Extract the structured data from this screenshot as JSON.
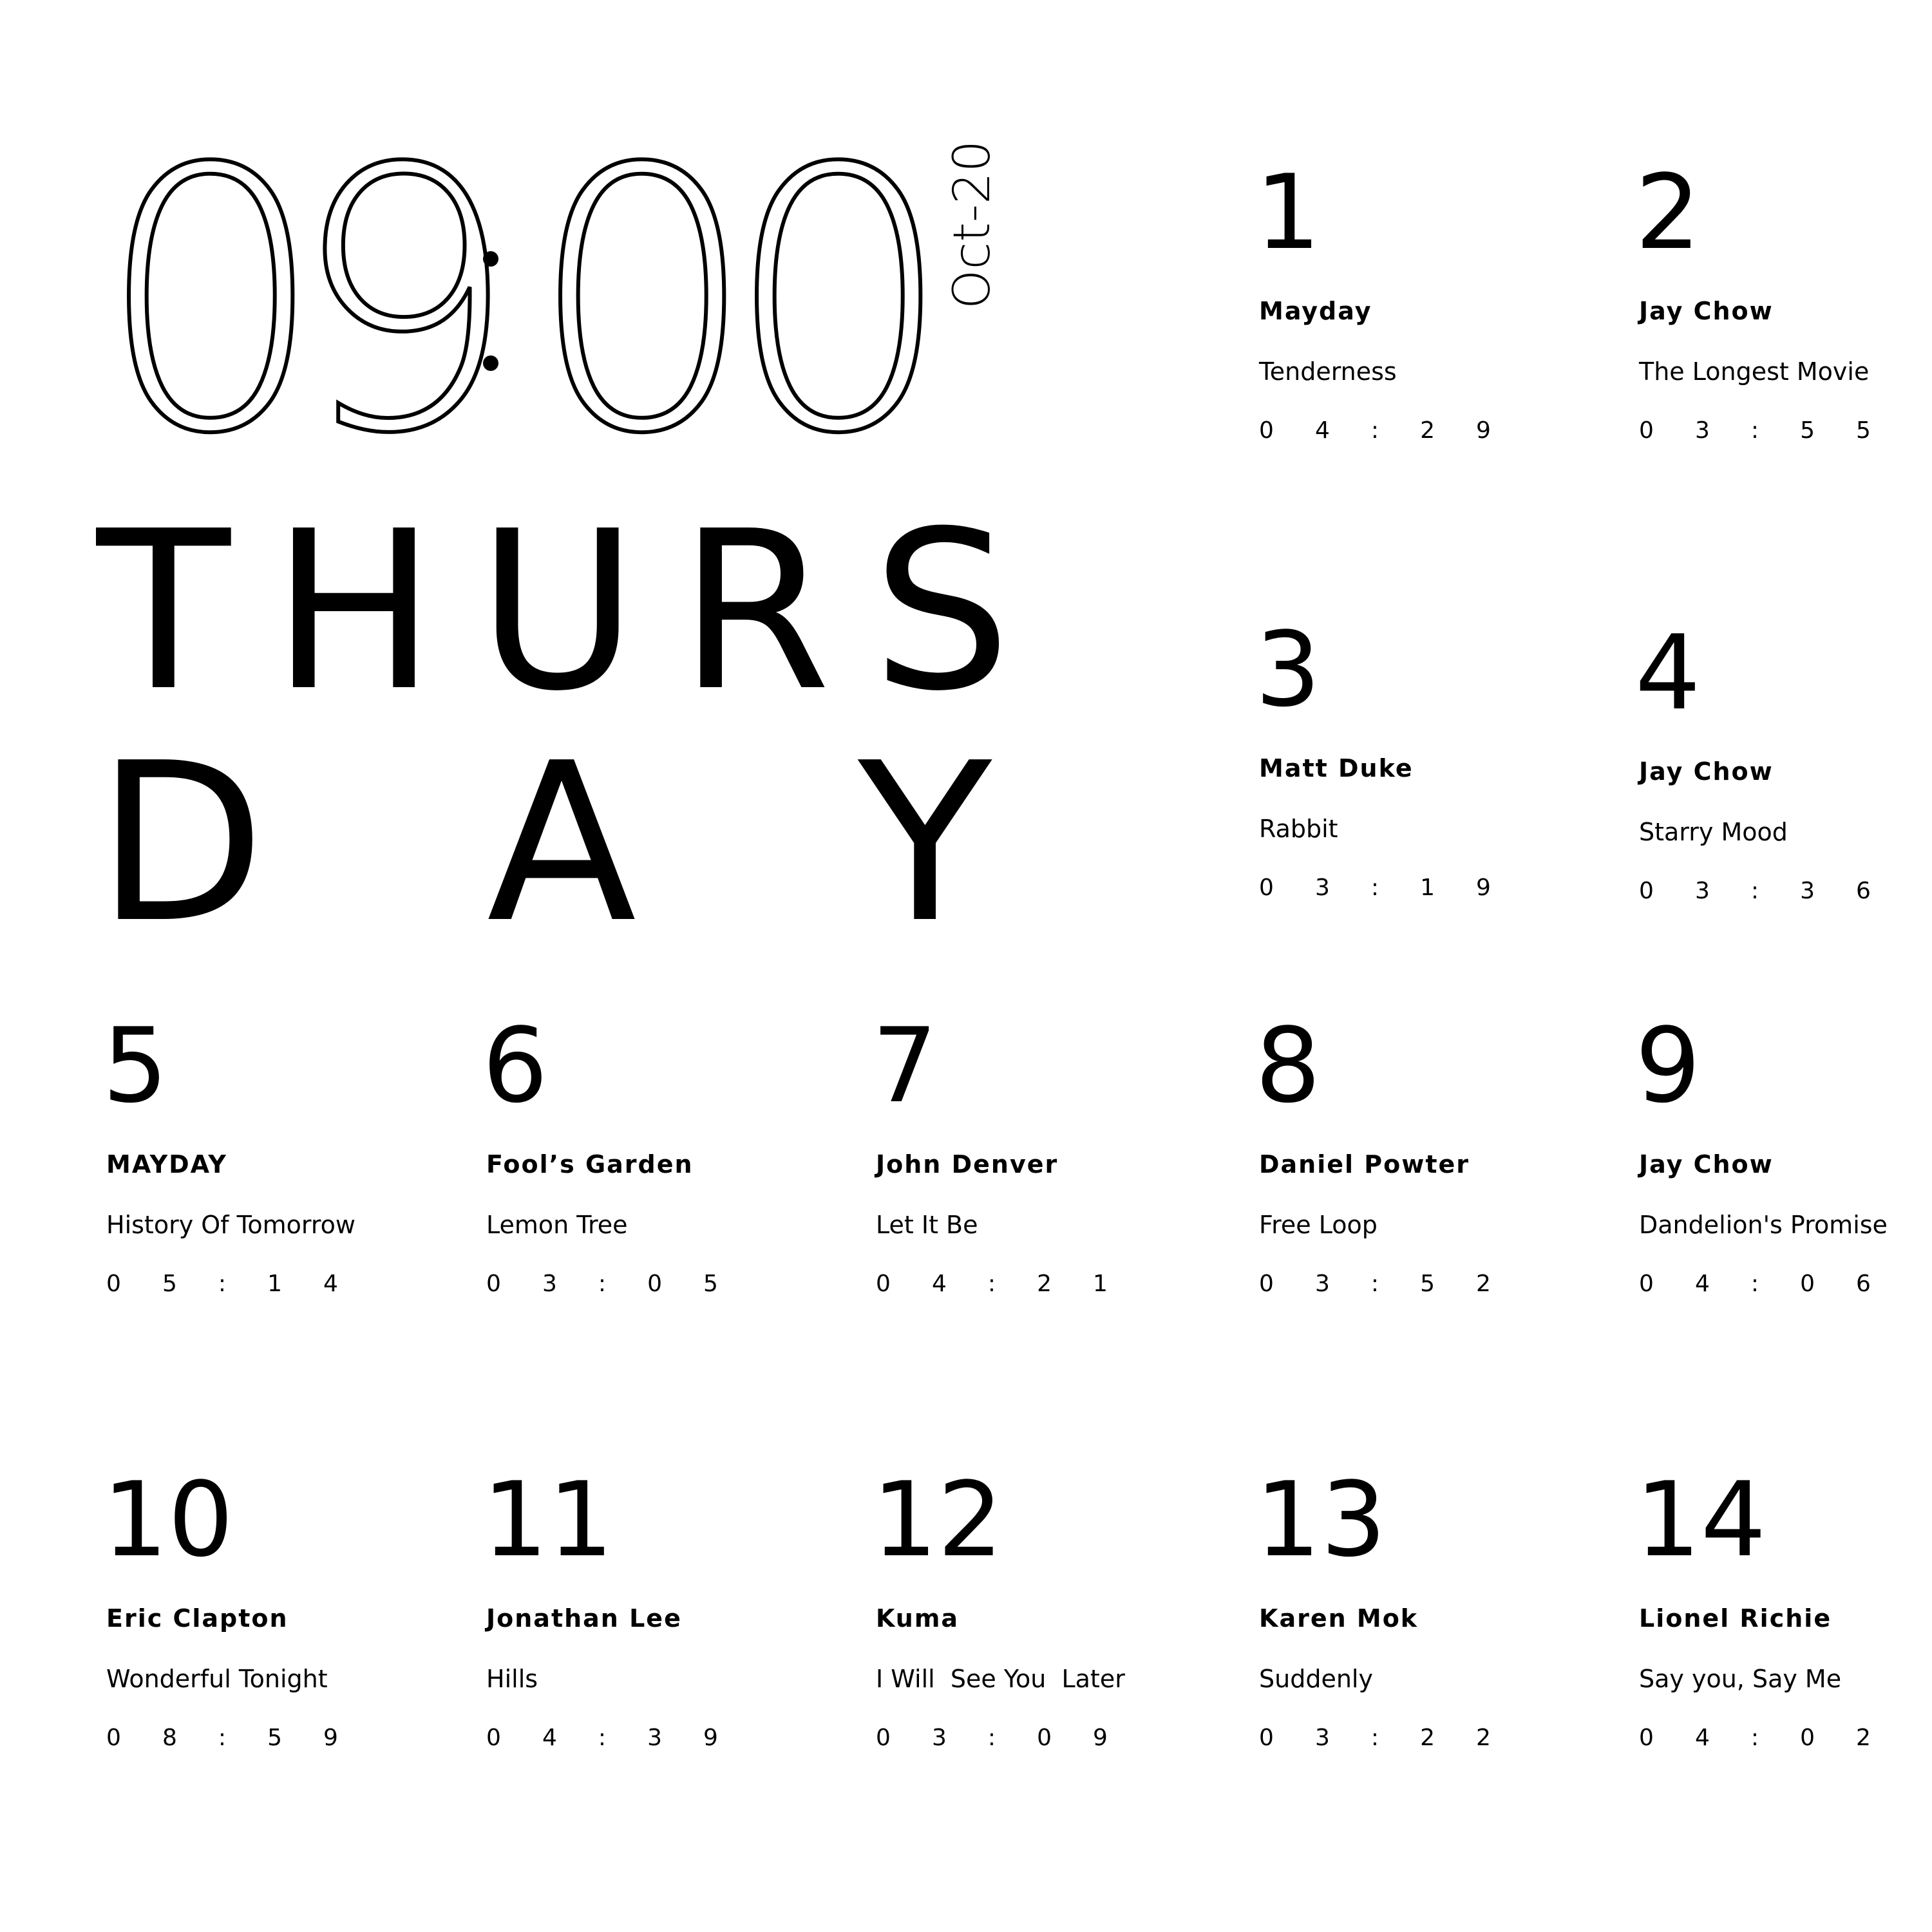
{
  "clock": {
    "digits": [
      "0",
      "9",
      "0",
      "0"
    ],
    "date": "Oct-20"
  },
  "day": {
    "line1": [
      "T",
      "H",
      "U",
      "R",
      "S"
    ],
    "line2": [
      "D",
      "A",
      "Y"
    ]
  },
  "songs": [
    {
      "rank": "1",
      "artist": "Mayday",
      "title": "Tenderness",
      "duration": [
        "0",
        "4",
        ":",
        "2",
        "9"
      ]
    },
    {
      "rank": "2",
      "artist": "Jay Chow",
      "title": "The Longest Movie",
      "duration": [
        "0",
        "3",
        ":",
        "5",
        "5"
      ]
    },
    {
      "rank": "3",
      "artist": "Matt Duke",
      "title": "Rabbit",
      "duration": [
        "0",
        "3",
        ":",
        "1",
        "9"
      ]
    },
    {
      "rank": "4",
      "artist": "Jay Chow",
      "title": "Starry Mood",
      "duration": [
        "0",
        "3",
        ":",
        "3",
        "6"
      ]
    },
    {
      "rank": "5",
      "artist": "MAYDAY",
      "title": "History Of Tomorrow",
      "duration": [
        "0",
        "5",
        ":",
        "1",
        "4"
      ]
    },
    {
      "rank": "6",
      "artist": "Fool’s Garden",
      "title": "Lemon Tree",
      "duration": [
        "0",
        "3",
        ":",
        "0",
        "5"
      ]
    },
    {
      "rank": "7",
      "artist": "John Denver",
      "title": "Let It Be",
      "duration": [
        "0",
        "4",
        ":",
        "2",
        "1"
      ]
    },
    {
      "rank": "8",
      "artist": "Daniel Powter",
      "title": "Free Loop",
      "duration": [
        "0",
        "3",
        ":",
        "5",
        "2"
      ]
    },
    {
      "rank": "9",
      "artist": "Jay Chow",
      "title": "Dandelion's Promise",
      "duration": [
        "0",
        "4",
        ":",
        "0",
        "6"
      ]
    },
    {
      "rank": "10",
      "artist": "Eric Clapton",
      "title": "Wonderful Tonight",
      "duration": [
        "0",
        "8",
        ":",
        "5",
        "9"
      ]
    },
    {
      "rank": "11",
      "artist": "Jonathan Lee",
      "title": "Hills",
      "duration": [
        "0",
        "4",
        ":",
        "3",
        "9"
      ]
    },
    {
      "rank": "12",
      "artist": "Kuma",
      "title": "I Will  See You  Later",
      "duration": [
        "0",
        "3",
        ":",
        "0",
        "9"
      ]
    },
    {
      "rank": "13",
      "artist": "Karen Mok",
      "title": "Suddenly",
      "duration": [
        "0",
        "3",
        ":",
        "2",
        "2"
      ]
    },
    {
      "rank": "14",
      "artist": "Lionel Richie",
      "title": "Say you, Say Me",
      "duration": [
        "0",
        "4",
        ":",
        "0",
        "2"
      ]
    }
  ]
}
